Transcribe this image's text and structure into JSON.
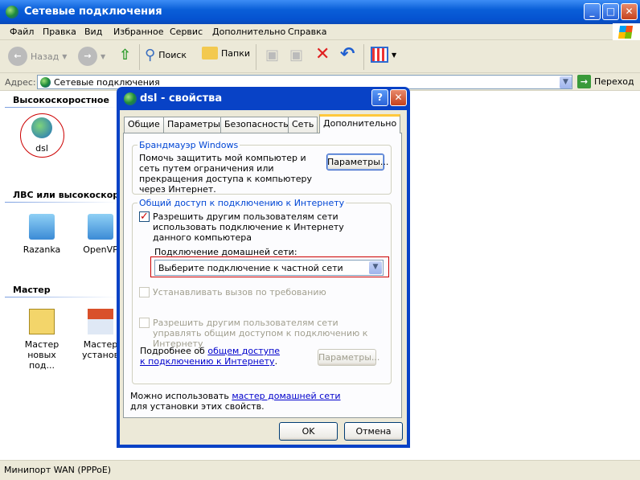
{
  "window": {
    "title": "Сетевые подключения"
  },
  "menu": [
    "Файл",
    "Правка",
    "Вид",
    "Избранное",
    "Сервис",
    "Дополнительно",
    "Справка"
  ],
  "toolbar": {
    "back": "Назад",
    "search": "Поиск",
    "folders": "Папки"
  },
  "address": {
    "label": "Адрес:",
    "value": "Сетевые подключения",
    "go": "Переход"
  },
  "groups": [
    {
      "title": "Высокоскоростное",
      "items": [
        "dsl"
      ]
    },
    {
      "title": "ЛВС или высокоскорос",
      "items": [
        "Razanka",
        "OpenVP"
      ]
    },
    {
      "title": "Мастер",
      "items": [
        "Мастер новых под...",
        "Мастер установ"
      ]
    }
  ],
  "status": "Минипорт WAN (PPPoE)",
  "dialog": {
    "title": "dsl - свойства",
    "tabs": [
      "Общие",
      "Параметры",
      "Безопасность",
      "Сеть",
      "Дополнительно"
    ],
    "firewall": {
      "legend": "Брандмауэр Windows",
      "text": "Помочь защитить мой компьютер и сеть путем ограничения или прекращения доступа к компьютеру через Интернет.",
      "button": "Параметры..."
    },
    "ics": {
      "legend": "Общий доступ к подключению к Интернету",
      "allow": "Разрешить другим пользователям сети использовать подключение к Интернету данного компьютера",
      "allow_checked": true,
      "home_label": "Подключение домашней сети:",
      "home_value": "Выберите подключение к частной сети",
      "dial": "Устанавливать вызов по требованию",
      "control": "Разрешить другим пользователям сети управлять общим доступом к подключению к Интернету",
      "more_prefix": "Подробнее об ",
      "more_link": "общем доступе к подключению к Интернету",
      "more_suffix": ".",
      "button": "Параметры..."
    },
    "wizard_prefix": "Можно использовать ",
    "wizard_link": "мастер домашней сети",
    "wizard_suffix": "для установки этих свойств.",
    "ok": "OK",
    "cancel": "Отмена"
  },
  "colors": {
    "titlebar": "#0553d0",
    "dialog_frame": "#0842c6",
    "annotation": "#cc0000"
  }
}
